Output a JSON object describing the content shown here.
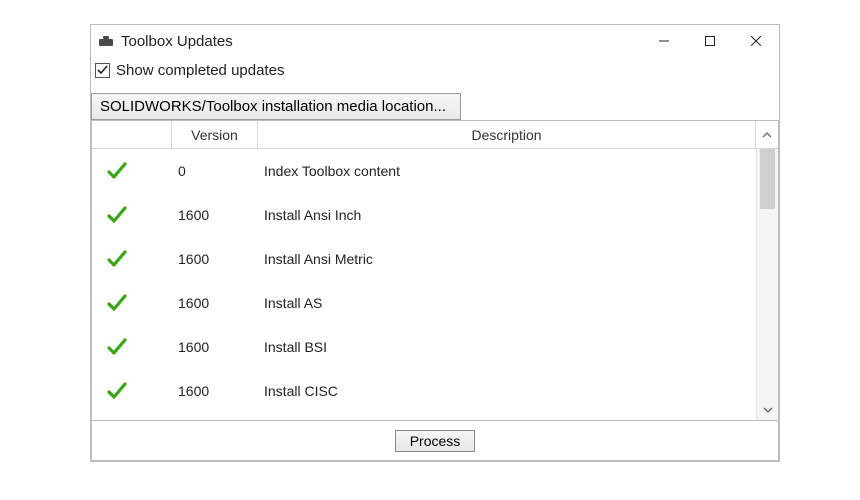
{
  "window": {
    "title": "Toolbox Updates"
  },
  "checkbox": {
    "show_completed_label": "Show completed updates",
    "checked": true
  },
  "media_button": {
    "label": "SOLIDWORKS/Toolbox installation media location..."
  },
  "columns": {
    "status": "",
    "version": "Version",
    "description": "Description"
  },
  "rows": [
    {
      "status": "done",
      "version": "0",
      "description": "Index Toolbox content"
    },
    {
      "status": "done",
      "version": "1600",
      "description": "Install Ansi Inch"
    },
    {
      "status": "done",
      "version": "1600",
      "description": "Install Ansi Metric"
    },
    {
      "status": "done",
      "version": "1600",
      "description": "Install AS"
    },
    {
      "status": "done",
      "version": "1600",
      "description": "Install BSI"
    },
    {
      "status": "done",
      "version": "1600",
      "description": "Install CISC"
    }
  ],
  "footer": {
    "process_label": "Process"
  }
}
